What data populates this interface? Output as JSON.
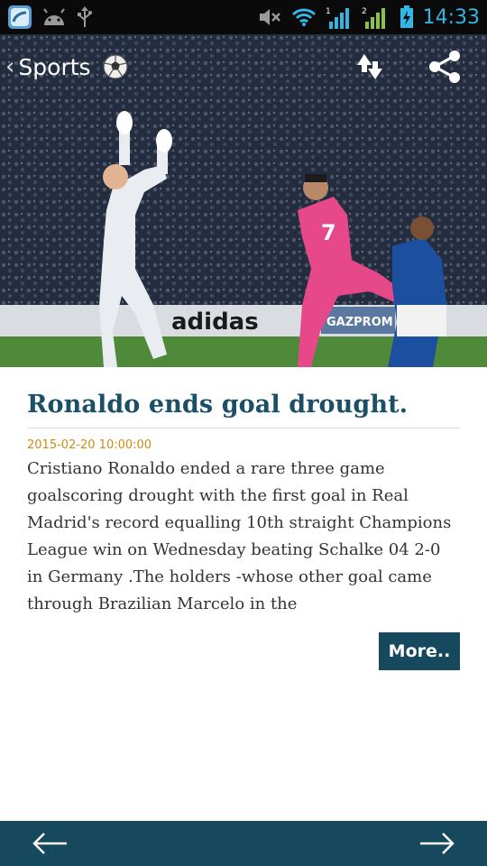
{
  "status_bar": {
    "time": "14:33",
    "icons": [
      "app-icon",
      "android-icon",
      "usb-icon",
      "mute-icon",
      "wifi-icon",
      "signal-sim1-icon",
      "signal-sim2-icon",
      "battery-charging-icon"
    ]
  },
  "toolbar": {
    "back_label": "Sports",
    "icons": [
      "back-chevron-icon",
      "soccer-ball-icon",
      "refresh-icon",
      "share-icon"
    ]
  },
  "hero": {
    "advert_text": "adidas",
    "advert_text_2": "GAZPROM",
    "player_number": "7"
  },
  "article": {
    "title": "Ronaldo ends goal drought.",
    "date": "2015-02-20 10:00:00",
    "body": "Cristiano Ronaldo ended a rare three game goalscoring drought with the first goal in Real Madrid's record equalling 10th straight Champions League win on Wednesday beating Schalke 04 2-0 in Germany .The holders -whose other goal came through Brazilian Marcelo in the",
    "more_label": "More.."
  },
  "bottom_nav": {
    "icons": [
      "arrow-left-icon",
      "arrow-right-icon"
    ]
  },
  "colors": {
    "headline": "#1b4f67",
    "date": "#d18a12",
    "bar": "#16485e",
    "status_time": "#33b5e5"
  }
}
